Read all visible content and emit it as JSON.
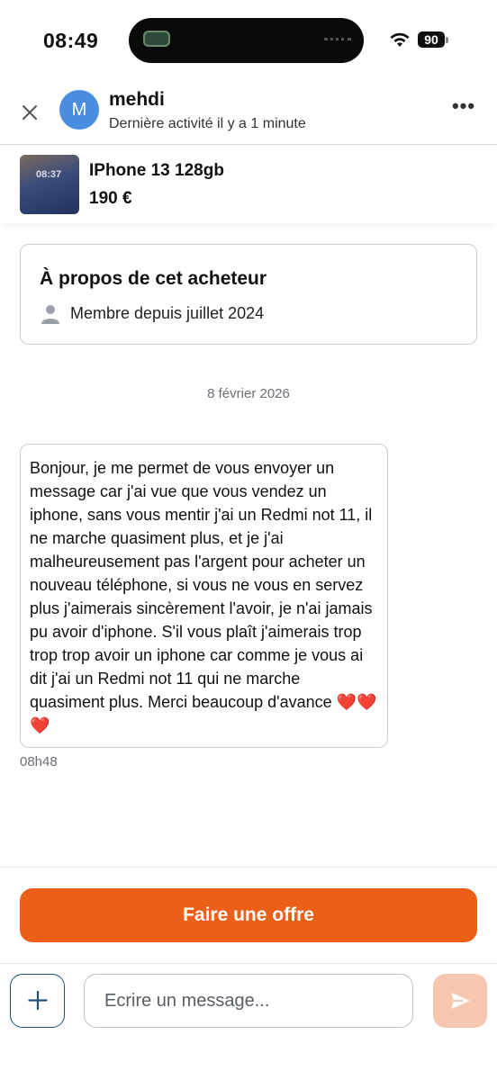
{
  "status_bar": {
    "time": "08:49",
    "battery": "90"
  },
  "header": {
    "avatar_initial": "M",
    "user_name": "mehdi",
    "last_activity": "Dernière activité il y a 1 minute"
  },
  "product": {
    "thumb_clock": "08:37",
    "title": "IPhone 13 128gb",
    "price": "190 €"
  },
  "about": {
    "title": "À propos de cet acheteur",
    "member_since": "Membre depuis juillet 2024"
  },
  "conversation": {
    "date": "8 février 2026",
    "messages": [
      {
        "text": "Bonjour, je me permet de vous envoyer un message car j'ai vue que vous vendez un iphone, sans vous mentir j'ai un Redmi not 11, il ne marche quasiment plus, et je j'ai malheureusement pas l'argent pour acheter un nouveau téléphone, si vous ne vous en servez plus j'aimerais sincèrement l'avoir, je n'ai jamais pu avoir d'iphone. S'il vous plaît j'aimerais trop trop trop avoir un iphone car comme je vous ai dit j'ai un Redmi not 11 qui ne marche quasiment plus. Merci beaucoup d'avance ❤️❤️❤️",
        "time": "08h48"
      }
    ]
  },
  "actions": {
    "offer_label": "Faire une offre"
  },
  "composer": {
    "placeholder": "Ecrire un message..."
  },
  "colors": {
    "accent": "#ec5f17",
    "send_disabled": "#f6c6b0",
    "avatar": "#4a8de0",
    "plus_border": "#1d4f78"
  }
}
